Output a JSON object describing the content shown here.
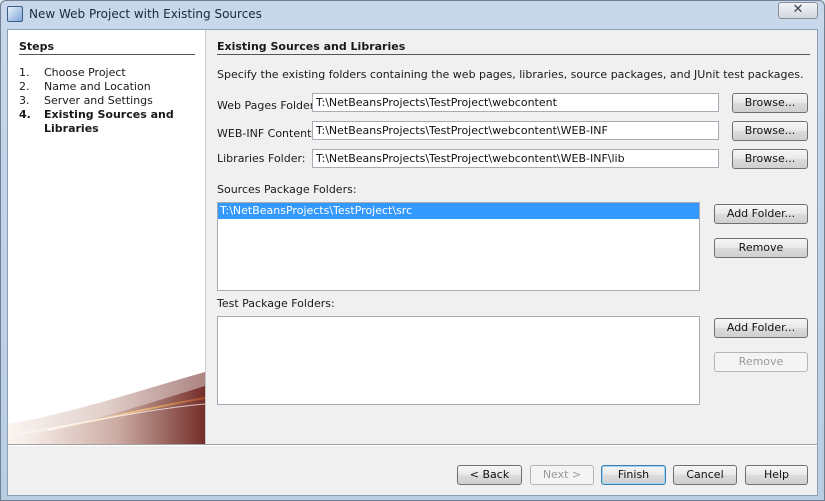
{
  "window": {
    "title": "New Web Project with Existing Sources",
    "close_glyph": "✕"
  },
  "steps": {
    "heading": "Steps",
    "items": [
      {
        "num": "1.",
        "label": "Choose Project"
      },
      {
        "num": "2.",
        "label": "Name and Location"
      },
      {
        "num": "3.",
        "label": "Server and Settings"
      },
      {
        "num": "4.",
        "label": "Existing Sources and Libraries"
      }
    ]
  },
  "panel": {
    "title": "Existing Sources and Libraries",
    "description": "Specify the existing folders containing the web pages, libraries, source packages, and JUnit test packages.",
    "web_pages": {
      "label": "Web Pages Folder:",
      "value": "T:\\NetBeansProjects\\TestProject\\webcontent",
      "browse": "Browse..."
    },
    "web_inf": {
      "label": "WEB-INF Content:",
      "value": "T:\\NetBeansProjects\\TestProject\\webcontent\\WEB-INF",
      "browse": "Browse..."
    },
    "libraries": {
      "label": "Libraries Folder:",
      "value": "T:\\NetBeansProjects\\TestProject\\webcontent\\WEB-INF\\lib",
      "browse": "Browse..."
    },
    "sources": {
      "label": "Sources Package Folders:",
      "items": [
        "T:\\NetBeansProjects\\TestProject\\src"
      ],
      "add": "Add Folder...",
      "remove": "Remove"
    },
    "tests": {
      "label": "Test Package Folders:",
      "items": [],
      "add": "Add Folder...",
      "remove": "Remove"
    }
  },
  "footer": {
    "back": "< Back",
    "next": "Next >",
    "finish": "Finish",
    "cancel": "Cancel",
    "help": "Help"
  },
  "colors": {
    "selection": "#3399ff",
    "steps_bg": "#ffffff",
    "dialog_bg": "#f0f0f0",
    "accent": "#7a2a1c"
  }
}
